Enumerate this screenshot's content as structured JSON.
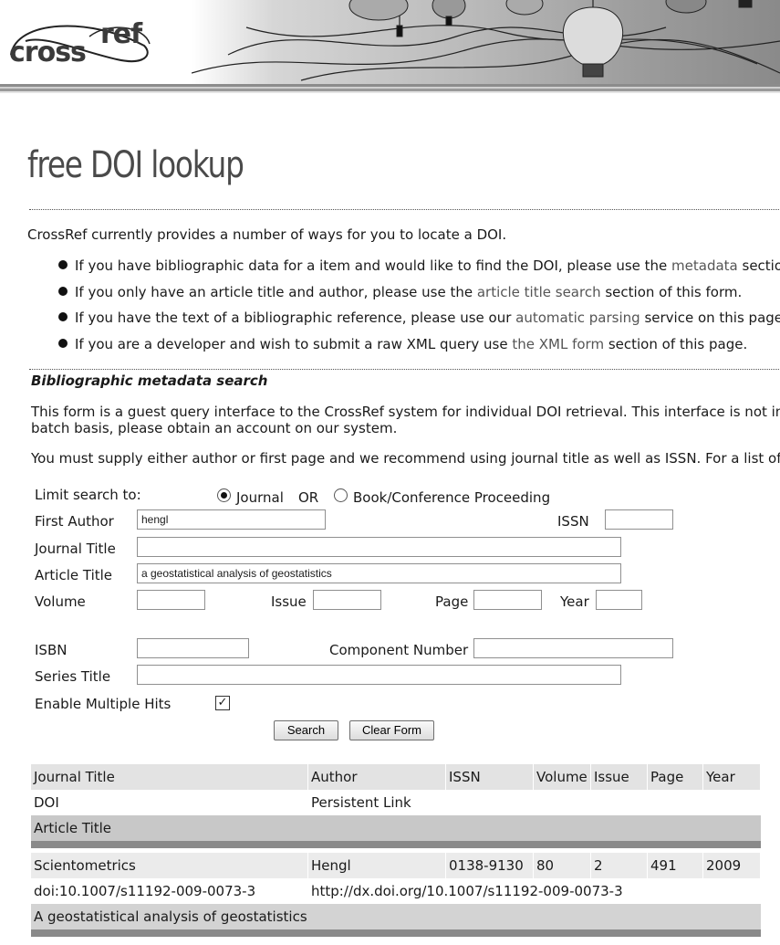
{
  "header": {
    "logo_text_1": "cross",
    "logo_text_2": "ref"
  },
  "page_title": "free DOI lookup",
  "intro": "CrossRef currently provides a number of ways for you to locate a DOI.",
  "bullets": [
    {
      "pre": "If you have bibliographic data for a item and would like to find the DOI, please use the ",
      "link": "metadata",
      "post": " section"
    },
    {
      "pre": "If you only have an article title and author, please use the ",
      "link": "article title search",
      "post": " section of this form."
    },
    {
      "pre": "If you have the text of a bibliographic reference, please use our ",
      "link": "automatic parsing",
      "post": " service on this page."
    },
    {
      "pre": "If you are a developer and wish to submit a raw XML query use ",
      "link": "the XML form",
      "post": " section of this page."
    }
  ],
  "section_title": "Bibliographic metadata search",
  "para1_line1": "This form is a guest query interface to the CrossRef system for individual DOI retrieval. This interface is not inte",
  "para1_line2": "batch basis, please obtain an account on our system.",
  "para2": "You must supply either author or first page and we recommend using journal title as well as ISSN. For a list of j",
  "form": {
    "limit_label": "Limit search to:",
    "radio_journal": "Journal",
    "or_text": "OR",
    "radio_book": "Book/Conference Proceeding",
    "radio_selected": "Journal",
    "first_author_label": "First Author",
    "first_author_value": "hengl",
    "issn_label": "ISSN",
    "issn_value": "",
    "journal_title_label": "Journal Title",
    "journal_title_value": "",
    "article_title_label": "Article Title",
    "article_title_value": "a geostatistical analysis of geostatistics",
    "volume_label": "Volume",
    "volume_value": "",
    "issue_label": "Issue",
    "issue_value": "",
    "page_label": "Page",
    "page_value": "",
    "year_label": "Year",
    "year_value": "",
    "isbn_label": "ISBN",
    "isbn_value": "",
    "component_label": "Component Number",
    "component_value": "",
    "series_title_label": "Series Title",
    "series_title_value": "",
    "multiple_hits_label": "Enable Multiple Hits",
    "multiple_hits_checked": true,
    "search_button": "Search",
    "clear_button": "Clear Form"
  },
  "results": {
    "headers": {
      "journal_title": "Journal Title",
      "author": "Author",
      "issn": "ISSN",
      "volume": "Volume",
      "issue": "Issue",
      "page": "Page",
      "year": "Year",
      "doi": "DOI",
      "persistent_link": "Persistent Link",
      "article_title": "Article Title"
    },
    "row": {
      "journal_title": "Scientometrics",
      "author": "Hengl",
      "issn": "0138-9130",
      "volume": "80",
      "issue": "2",
      "page": "491",
      "year": "2009",
      "doi": "doi:10.1007/s11192-009-0073-3",
      "persistent_link": "http://dx.doi.org/10.1007/s11192-009-0073-3",
      "article_title": "A geostatistical analysis of geostatistics"
    }
  }
}
